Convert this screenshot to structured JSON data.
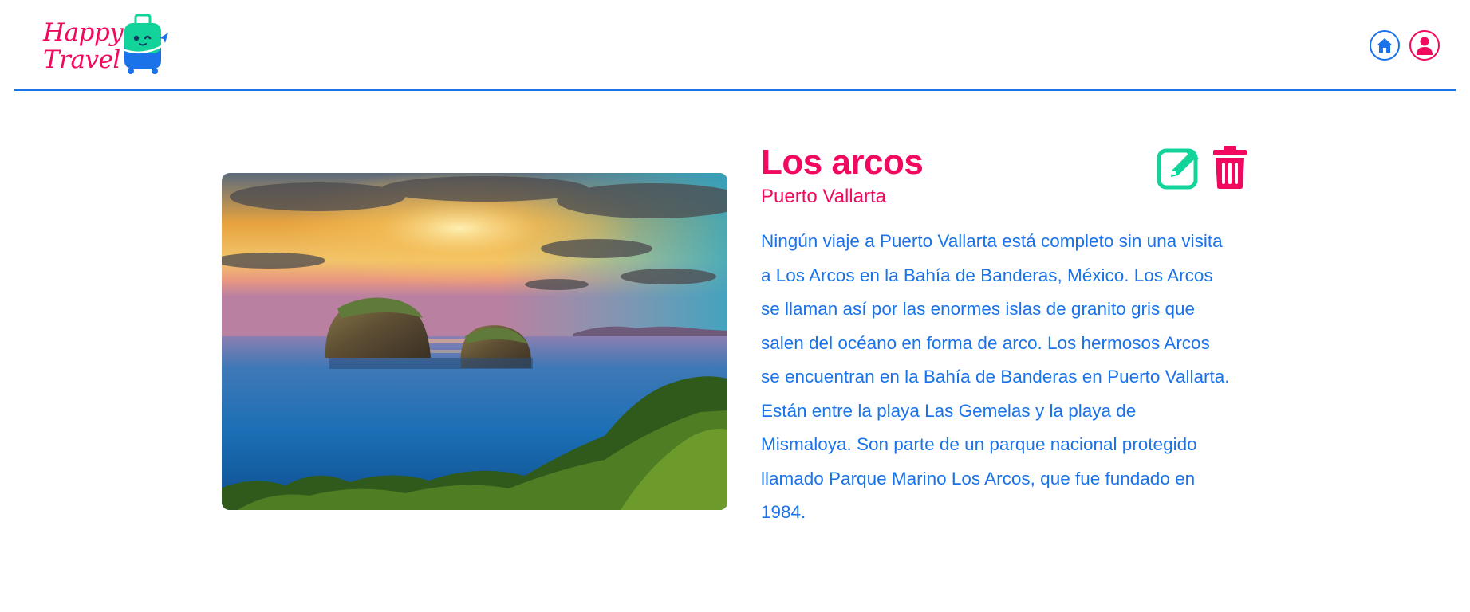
{
  "brand": {
    "line1": "Happy",
    "line2": "Travel",
    "primary_color": "#f0095e",
    "secondary_color": "#1a73e8",
    "accent_color": "#12d39a"
  },
  "header": {
    "icons": [
      "home-icon",
      "user-icon"
    ]
  },
  "place": {
    "title": "Los arcos",
    "location": "Puerto Vallarta",
    "description": "Ningún viaje a Puerto Vallarta está completo sin una visita a Los Arcos en la Bahía de Banderas, México. Los Arcos se llaman así por las enormes islas de granito gris que salen del océano en forma de arco. Los hermosos Arcos se encuentran en la Bahía de Banderas en Puerto Vallarta. Están entre la playa Las Gemelas y la playa de Mismaloya. Son parte de un parque nacional protegido llamado Parque Marino Los Arcos, que fue fundado en 1984."
  },
  "actions": {
    "icons": [
      "edit-icon",
      "trash-icon"
    ]
  }
}
